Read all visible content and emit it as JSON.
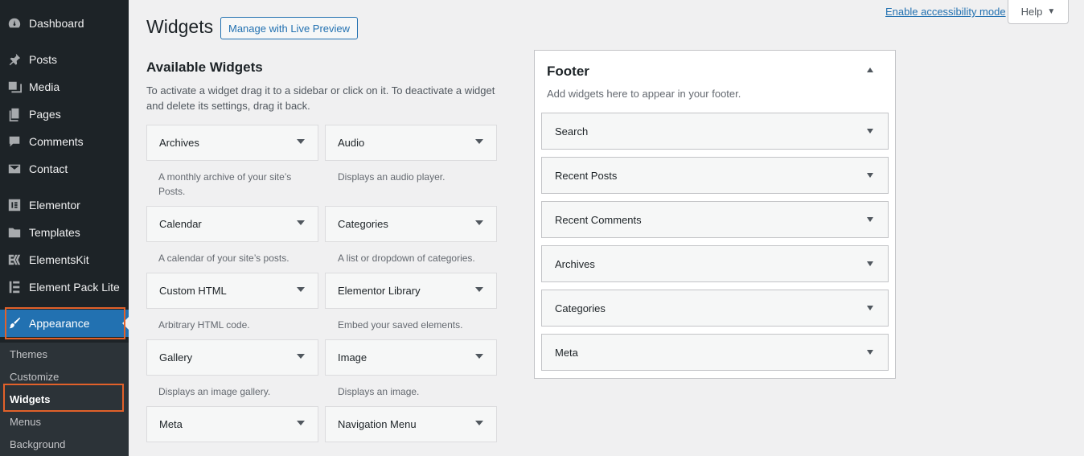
{
  "sidebar": {
    "menu": [
      {
        "label": "Dashboard",
        "icon": "dashboard-icon"
      },
      {
        "label": "Posts",
        "icon": "pin-icon"
      },
      {
        "label": "Media",
        "icon": "media-icon"
      },
      {
        "label": "Pages",
        "icon": "pages-icon"
      },
      {
        "label": "Comments",
        "icon": "comment-icon"
      },
      {
        "label": "Contact",
        "icon": "mail-icon"
      },
      {
        "label": "Elementor",
        "icon": "elementor-icon"
      },
      {
        "label": "Templates",
        "icon": "folder-icon"
      },
      {
        "label": "ElementsKit",
        "icon": "elementskit-icon"
      },
      {
        "label": "Element Pack Lite",
        "icon": "element-pack-icon"
      },
      {
        "label": "Appearance",
        "icon": "paintbrush-icon"
      }
    ],
    "submenu": [
      "Themes",
      "Customize",
      "Widgets",
      "Menus",
      "Background"
    ]
  },
  "header": {
    "title": "Widgets",
    "live_preview_label": "Manage with Live Preview",
    "accessibility_link": "Enable accessibility mode",
    "help_label": "Help"
  },
  "available": {
    "title": "Available Widgets",
    "description": "To activate a widget drag it to a sidebar or click on it. To deactivate a widget and delete its settings, drag it back.",
    "widgets": [
      {
        "name": "Archives",
        "desc": "A monthly archive of your site’s Posts."
      },
      {
        "name": "Audio",
        "desc": "Displays an audio player."
      },
      {
        "name": "Calendar",
        "desc": "A calendar of your site’s posts."
      },
      {
        "name": "Categories",
        "desc": "A list or dropdown of categories."
      },
      {
        "name": "Custom HTML",
        "desc": "Arbitrary HTML code."
      },
      {
        "name": "Elementor Library",
        "desc": "Embed your saved elements."
      },
      {
        "name": "Gallery",
        "desc": "Displays an image gallery."
      },
      {
        "name": "Image",
        "desc": "Displays an image."
      },
      {
        "name": "Meta",
        "desc": ""
      },
      {
        "name": "Navigation Menu",
        "desc": ""
      }
    ]
  },
  "footer": {
    "title": "Footer",
    "description": "Add widgets here to appear in your footer.",
    "widgets": [
      "Search",
      "Recent Posts",
      "Recent Comments",
      "Archives",
      "Categories",
      "Meta"
    ]
  },
  "colors": {
    "sidebar_bg": "#1d2327",
    "accent": "#2271b1",
    "highlight": "#e2612a"
  }
}
